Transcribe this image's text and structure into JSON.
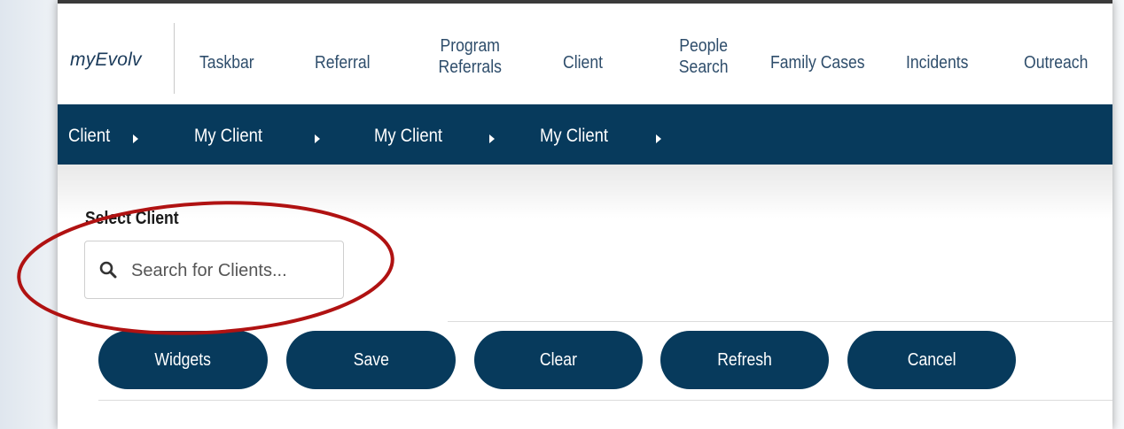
{
  "nav": {
    "brand": "myEvolv",
    "items": [
      {
        "label": "Taskbar"
      },
      {
        "label": "Referral"
      },
      {
        "label": "Program Referrals"
      },
      {
        "label": "Client"
      },
      {
        "label": "People Search"
      },
      {
        "label": "Family Cases"
      },
      {
        "label": "Incidents"
      },
      {
        "label": "Outreach"
      }
    ]
  },
  "breadcrumb": [
    "Client",
    "My Client",
    "My Client",
    "My Client"
  ],
  "form": {
    "select_label": "Select Client",
    "search_placeholder": "Search for Clients...",
    "search_value": ""
  },
  "buttons": {
    "widgets": "Widgets",
    "save": "Save",
    "clear": "Clear",
    "refresh": "Refresh",
    "cancel": "Cancel"
  },
  "icons": {
    "search": "search-icon",
    "crumb_separator": "caret-right-icon"
  },
  "colors": {
    "primary": "#073a5c",
    "nav_text": "#2e4d6b",
    "annotation": "#b01212"
  }
}
